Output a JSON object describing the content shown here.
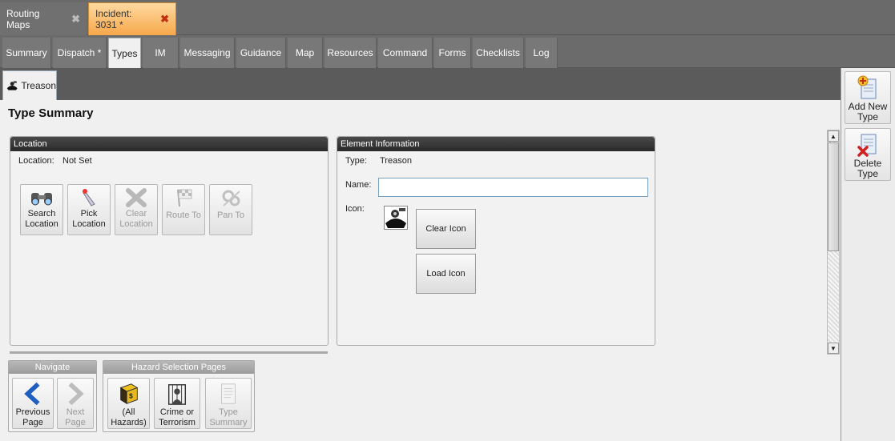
{
  "doc_tabs": [
    {
      "label": "Routing Maps",
      "close": "✖"
    },
    {
      "label": "Incident: 3031 *",
      "close": "✖"
    }
  ],
  "section_tabs": [
    "Summary",
    "Dispatch *",
    "Types",
    "IM",
    "Messaging",
    "Guidance",
    "Map",
    "Resources",
    "Command",
    "Forms",
    "Checklists",
    "Log"
  ],
  "active_section": "Types",
  "type_tab": {
    "label": "Treason",
    "icon": "treason-icon"
  },
  "page_title": "Type Summary",
  "location_panel": {
    "header": "Location",
    "location_label": "Location:",
    "location_value": "Not Set",
    "buttons": [
      {
        "line1": "Search",
        "line2": "Location",
        "icon": "binoculars-icon",
        "enabled": true
      },
      {
        "line1": "Pick",
        "line2": "Location",
        "icon": "pointer-icon",
        "enabled": true
      },
      {
        "line1": "Clear",
        "line2": "Location",
        "icon": "clear-x-icon",
        "enabled": false
      },
      {
        "line1": "Route To",
        "line2": "",
        "icon": "checkered-flag-icon",
        "enabled": false
      },
      {
        "line1": "Pan To",
        "line2": "",
        "icon": "pan-icon",
        "enabled": false
      }
    ]
  },
  "element_panel": {
    "header": "Element Information",
    "type_label": "Type:",
    "type_value": "Treason",
    "name_label": "Name:",
    "name_value": "",
    "icon_label": "Icon:",
    "clear_icon": "Clear Icon",
    "load_icon": "Load Icon"
  },
  "navigate": {
    "header": "Navigate",
    "previous": {
      "line1": "Previous",
      "line2": "Page",
      "enabled": true
    },
    "next": {
      "line1": "Next",
      "line2": "Page",
      "enabled": false
    }
  },
  "hazard_pages": {
    "header": "Hazard Selection Pages",
    "buttons": [
      {
        "line1": "(All",
        "line2": "Hazards)",
        "icon": "book-icon",
        "enabled": true
      },
      {
        "line1": "Crime or",
        "line2": "Terrorism",
        "icon": "crime-icon",
        "enabled": true
      },
      {
        "line1": "Type",
        "line2": "Summary",
        "icon": "document-icon",
        "enabled": false
      }
    ]
  },
  "sidebar": {
    "add": {
      "line1": "Add New",
      "line2": "Type"
    },
    "delete": {
      "line1": "Delete",
      "line2": "Type"
    }
  },
  "colors": {
    "active_doc_tab": "#f7a84a",
    "panel_header": "#2a2a2a",
    "accent_blue": "#1f5fbf"
  }
}
